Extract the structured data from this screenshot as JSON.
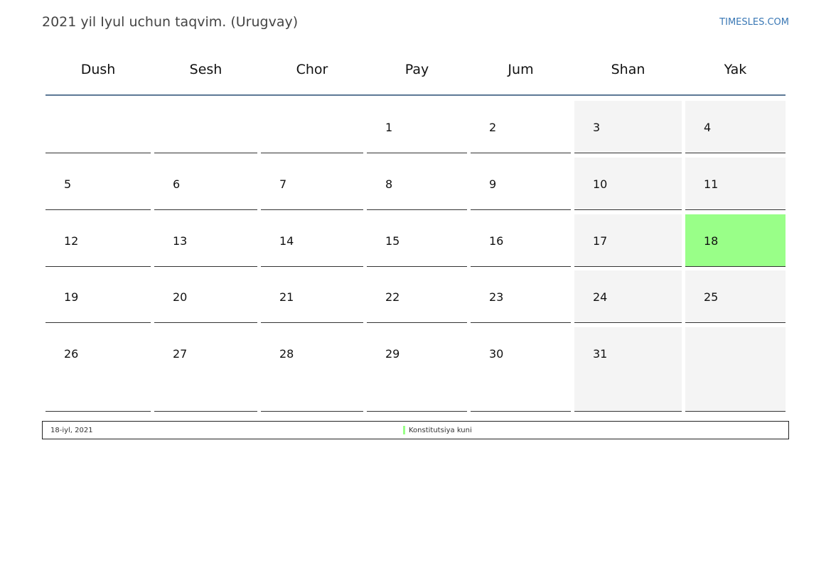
{
  "header": {
    "title": "2021 yil Iyul uchun taqvim. (Urugvay)",
    "site": "TIMESLES.COM"
  },
  "weekdays": [
    "Dush",
    "Sesh",
    "Chor",
    "Pay",
    "Jum",
    "Shan",
    "Yak"
  ],
  "weeks": [
    [
      "",
      "",
      "",
      "1",
      "2",
      "3",
      "4"
    ],
    [
      "5",
      "6",
      "7",
      "8",
      "9",
      "10",
      "11"
    ],
    [
      "12",
      "13",
      "14",
      "15",
      "16",
      "17",
      "18"
    ],
    [
      "19",
      "20",
      "21",
      "22",
      "23",
      "24",
      "25"
    ],
    [
      "26",
      "27",
      "28",
      "29",
      "30",
      "31",
      ""
    ]
  ],
  "holiday": {
    "day": "18",
    "date_label": "18-iyl, 2021",
    "name": "Konstitutsiya kuni",
    "color": "#99ff88"
  },
  "colors": {
    "weekend_bg": "#f4f4f4",
    "header_rule": "#5c7896",
    "link": "#3a78b5"
  }
}
